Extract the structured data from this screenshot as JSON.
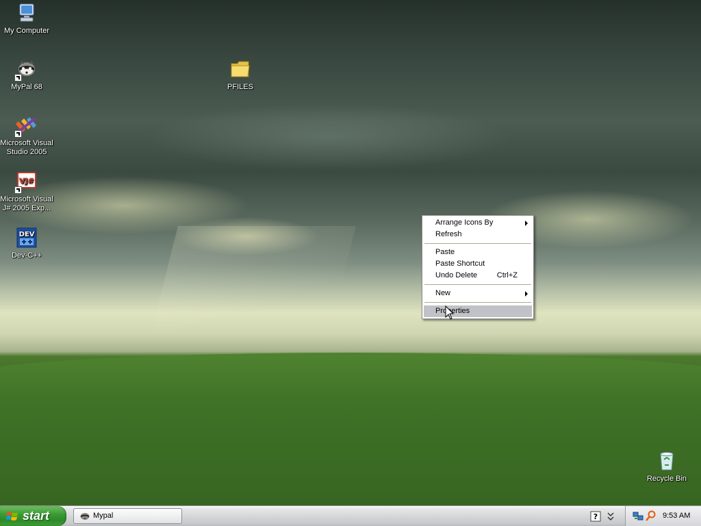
{
  "desktop": {
    "icons": [
      {
        "label": "My Computer",
        "icon": "my-computer-icon"
      },
      {
        "label": "MyPal 68",
        "icon": "mypal-raccoon-icon"
      },
      {
        "label": "Microsoft Visual Studio 2005",
        "icon": "visual-studio-icon"
      },
      {
        "label": "Microsoft Visual J# 2005 Exp...",
        "icon": "visual-jsharp-icon",
        "badge": "VJ#"
      },
      {
        "label": "Dev-C++",
        "icon": "dev-cpp-icon",
        "badge": "DEV"
      },
      {
        "label": "PFILES",
        "icon": "folder-icon"
      },
      {
        "label": "Recycle Bin",
        "icon": "recycle-bin-icon"
      }
    ]
  },
  "context_menu": {
    "items": [
      {
        "label": "Arrange Icons By",
        "submenu": true
      },
      {
        "label": "Refresh"
      },
      {
        "label": "Paste"
      },
      {
        "label": "Paste Shortcut"
      },
      {
        "label": "Undo Delete",
        "shortcut": "Ctrl+Z"
      },
      {
        "label": "New",
        "submenu": true
      },
      {
        "label": "Properties",
        "highlighted": true
      }
    ]
  },
  "taskbar": {
    "start_label": "start",
    "buttons": [
      {
        "label": "Mypal",
        "icon": "mypal-raccoon-icon"
      }
    ],
    "tray_icons": [
      "network-icon",
      "search-icon"
    ],
    "clock": "9:53 AM"
  },
  "colors": {
    "start_green": "#3c9b35",
    "menu_highlight": "#c1c2c7",
    "taskbar": "#d6d7d9"
  }
}
